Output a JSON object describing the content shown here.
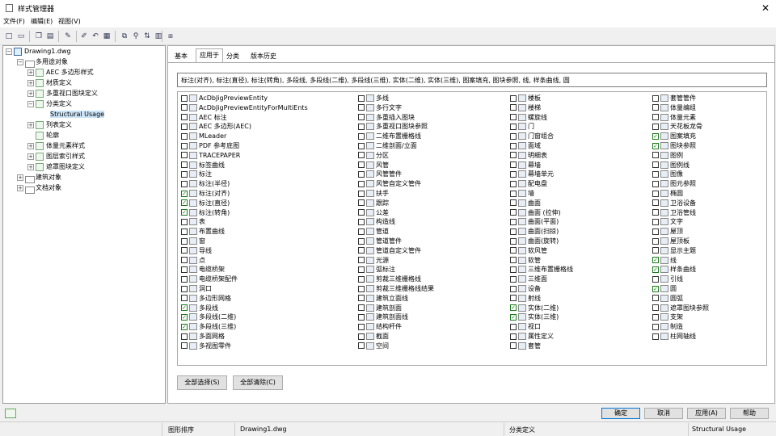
{
  "window": {
    "title": "样式管理器",
    "close": "✕"
  },
  "menu": [
    "文件(F)",
    "编辑(E)",
    "视图(V)"
  ],
  "toolbar_icons": [
    "new-icon",
    "open-icon",
    "copy-icon",
    "paste-icon",
    "edit-icon",
    "purge-icon",
    "undo-icon",
    "style-icon",
    "filter-icon",
    "sort-icon",
    "view-icon",
    "dock-icon"
  ],
  "tree": {
    "root": "Drawing1.dwg",
    "n1": "多用途对象",
    "n2": "AEC 多边形样式",
    "n3": "材质定义",
    "n4": "多重视口图块定义",
    "n5": "分类定义",
    "n6": "Structural Usage",
    "n7": "列表定义",
    "n8": "轮廓",
    "n9": "体量元素样式",
    "n10": "图层索引样式",
    "n11": "遮罩图块定义",
    "n12": "建筑对象",
    "n13": "文档对象"
  },
  "tabs": [
    "基本",
    "应用于",
    "分类",
    "版本历史"
  ],
  "applies_text": "标注(对齐), 标注(直径), 标注(转角), 多段线, 多段线(二维), 多段线(三维), 实体(二维), 实体(三维), 图案填充, 图块参照, 线, 样条曲线, 圆",
  "col1": [
    [
      "AcDbJigPreviewEntity",
      0
    ],
    [
      "AcDbJigPreviewEntityForMultiEnts",
      0
    ],
    [
      "AEC 标注",
      0
    ],
    [
      "AEC 多边形(AEC)",
      0
    ],
    [
      "MLeader",
      0
    ],
    [
      "PDF 参考底图",
      0
    ],
    [
      "TRACEPAPER",
      0
    ],
    [
      "标签曲线",
      0
    ],
    [
      "标注",
      0
    ],
    [
      "标注(半径)",
      0
    ],
    [
      "标注(对齐)",
      1
    ],
    [
      "标注(直径)",
      1
    ],
    [
      "标注(转角)",
      1
    ],
    [
      "表",
      0
    ],
    [
      "布置曲线",
      0
    ],
    [
      "窗",
      0
    ],
    [
      "导线",
      0
    ],
    [
      "点",
      0
    ],
    [
      "电缆桥架",
      0
    ],
    [
      "电缆桥架配件",
      0
    ],
    [
      "洞口",
      0
    ],
    [
      "多边形网格",
      0
    ],
    [
      "多段线",
      1
    ],
    [
      "多段线(二维)",
      1
    ],
    [
      "多段线(三维)",
      1
    ],
    [
      "多面网格",
      0
    ],
    [
      "多视图零件",
      0
    ]
  ],
  "col2": [
    [
      "多线",
      0
    ],
    [
      "多行文字",
      0
    ],
    [
      "多重插入图块",
      0
    ],
    [
      "多重视口图块参照",
      0
    ],
    [
      "二维布置栅格线",
      0
    ],
    [
      "二维剖面/立面",
      0
    ],
    [
      "分区",
      0
    ],
    [
      "风管",
      0
    ],
    [
      "风管管件",
      0
    ],
    [
      "风管自定义管件",
      0
    ],
    [
      "扶手",
      0
    ],
    [
      "跟踪",
      0
    ],
    [
      "公差",
      0
    ],
    [
      "构造线",
      0
    ],
    [
      "管道",
      0
    ],
    [
      "管道管件",
      0
    ],
    [
      "管道自定义管件",
      0
    ],
    [
      "光源",
      0
    ],
    [
      "弧标注",
      0
    ],
    [
      "剪裁三维栅格线",
      0
    ],
    [
      "剪裁三维栅格线结果",
      0
    ],
    [
      "建筑立面线",
      0
    ],
    [
      "建筑剖面",
      0
    ],
    [
      "建筑剖面线",
      0
    ],
    [
      "结构杆件",
      0
    ],
    [
      "截面",
      0
    ],
    [
      "空间",
      0
    ]
  ],
  "col3": [
    [
      "楼板",
      0
    ],
    [
      "楼梯",
      0
    ],
    [
      "螺旋线",
      0
    ],
    [
      "门",
      0
    ],
    [
      "门窗组合",
      0
    ],
    [
      "面域",
      0
    ],
    [
      "明细表",
      0
    ],
    [
      "幕墙",
      0
    ],
    [
      "幕墙单元",
      0
    ],
    [
      "配电盘",
      0
    ],
    [
      "墙",
      0
    ],
    [
      "曲面",
      0
    ],
    [
      "曲面 (拉伸)",
      0
    ],
    [
      "曲面(平面)",
      0
    ],
    [
      "曲面(扫掠)",
      0
    ],
    [
      "曲面(旋转)",
      0
    ],
    [
      "软风管",
      0
    ],
    [
      "软管",
      0
    ],
    [
      "三维布置栅格线",
      0
    ],
    [
      "三维面",
      0
    ],
    [
      "设备",
      0
    ],
    [
      "射线",
      0
    ],
    [
      "实体(二维)",
      1
    ],
    [
      "实体(三维)",
      1
    ],
    [
      "视口",
      0
    ],
    [
      "属性定义",
      0
    ],
    [
      "套管",
      0
    ]
  ],
  "col4": [
    [
      "套管管件",
      0
    ],
    [
      "体量编组",
      0
    ],
    [
      "体量元素",
      0
    ],
    [
      "天花板龙骨",
      0
    ],
    [
      "图案填充",
      1
    ],
    [
      "图块参照",
      1
    ],
    [
      "图例",
      0
    ],
    [
      "图例线",
      0
    ],
    [
      "图像",
      0
    ],
    [
      "图元参照",
      0
    ],
    [
      "椭圆",
      0
    ],
    [
      "卫浴设备",
      0
    ],
    [
      "卫浴管线",
      0
    ],
    [
      "文字",
      0
    ],
    [
      "屋顶",
      0
    ],
    [
      "屋顶板",
      0
    ],
    [
      "显示主题",
      0
    ],
    [
      "线",
      1
    ],
    [
      "样条曲线",
      1
    ],
    [
      "引线",
      0
    ],
    [
      "圆",
      1
    ],
    [
      "圆弧",
      0
    ],
    [
      "遮罩图块参照",
      0
    ],
    [
      "支架",
      0
    ],
    [
      "制造",
      0
    ],
    [
      "柱网轴线",
      0
    ]
  ],
  "buttons": {
    "select_all": "全部选择(S)",
    "clear_all": "全部清除(C)",
    "ok": "确定",
    "cancel": "取消",
    "apply": "应用(A)",
    "help": "帮助"
  },
  "status": {
    "s1": "图形排序",
    "s2": "Drawing1.dwg",
    "s3": "分类定义",
    "s4": "Structural Usage"
  }
}
